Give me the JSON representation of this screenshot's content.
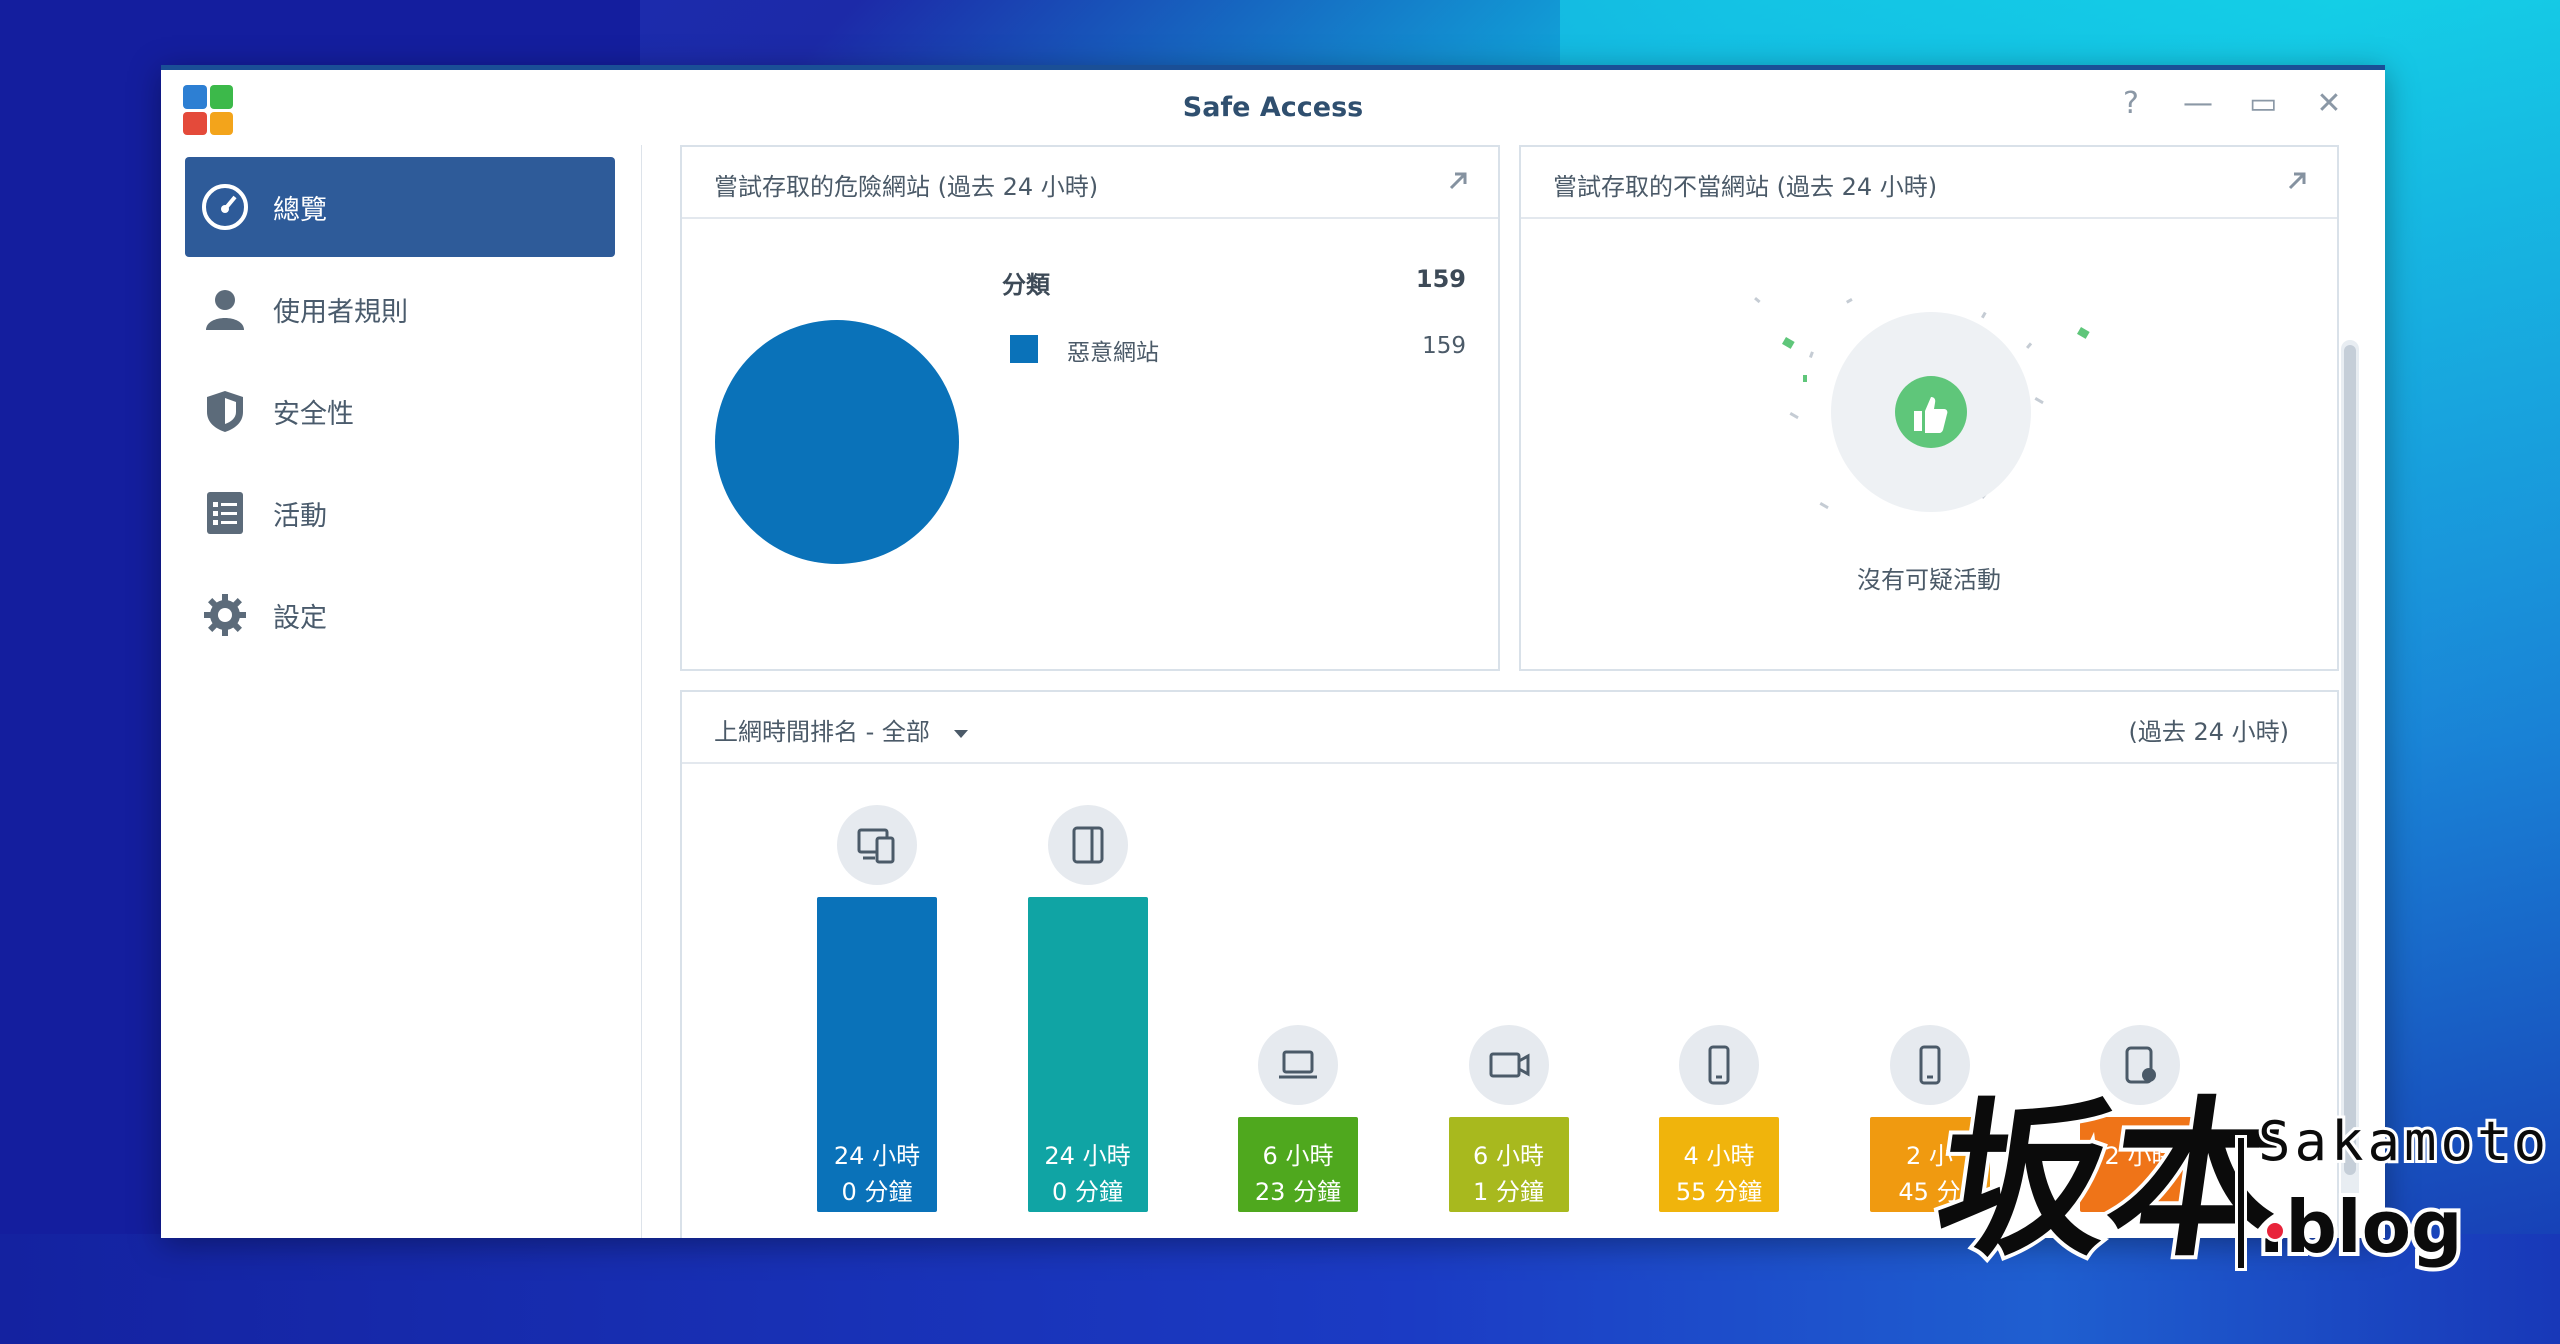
{
  "window": {
    "title": "Safe Access",
    "controls": [
      "?",
      "—",
      "▭",
      "✕"
    ]
  },
  "sidebar": {
    "items": [
      {
        "label": "總覽",
        "icon": "dashboard-icon",
        "active": true
      },
      {
        "label": "使用者規則",
        "icon": "user-icon",
        "active": false
      },
      {
        "label": "安全性",
        "icon": "shield-icon",
        "active": false
      },
      {
        "label": "活動",
        "icon": "list-icon",
        "active": false
      },
      {
        "label": "設定",
        "icon": "gear-icon",
        "active": false
      }
    ]
  },
  "panel_dangerous": {
    "title": "嘗試存取的危險網站 (過去 24 小時)",
    "legend_header": "分類",
    "legend_total": "159",
    "legend_items": [
      {
        "label": "惡意網站",
        "value": "159",
        "color": "#0a72b9"
      }
    ]
  },
  "chart_data": {
    "type": "pie",
    "title": "嘗試存取的危險網站 (過去 24 小時)",
    "categories": [
      "惡意網站"
    ],
    "values": [
      159
    ]
  },
  "panel_inappropriate": {
    "title": "嘗試存取的不當網站 (過去 24 小時)",
    "empty_text": "沒有可疑活動"
  },
  "panel_ranking": {
    "title": "上網時間排名 - 全部",
    "period": "(過去 24 小時)",
    "bars": [
      {
        "icon": "devices-icon",
        "line1": "24 小時",
        "line2": "0 分鐘",
        "color": "#0a72b9",
        "fraction": 1.0
      },
      {
        "icon": "tablet-icon",
        "line1": "24 小時",
        "line2": "0 分鐘",
        "color": "#10a4a4",
        "fraction": 1.0
      },
      {
        "icon": "laptop-icon",
        "line1": "6 小時",
        "line2": "23 分鐘",
        "color": "#4fa81e",
        "fraction": 0.27
      },
      {
        "icon": "camera-icon",
        "line1": "6 小時",
        "line2": "1 分鐘",
        "color": "#a8b91e",
        "fraction": 0.25
      },
      {
        "icon": "phone-icon",
        "line1": "4 小時",
        "line2": "55 分鐘",
        "color": "#f0b40c",
        "fraction": 0.21
      },
      {
        "icon": "phone-icon",
        "line1": "2 小",
        "line2": "45 分",
        "color": "#f09a10",
        "fraction": 0.11
      },
      {
        "icon": "storage-icon",
        "line1": "2 小時",
        "line2": "",
        "color": "#ef7418",
        "fraction": 0.1
      }
    ]
  },
  "watermark": {
    "kanji": "坂本",
    "name": "Sakamoto",
    "domain": ".blog"
  }
}
